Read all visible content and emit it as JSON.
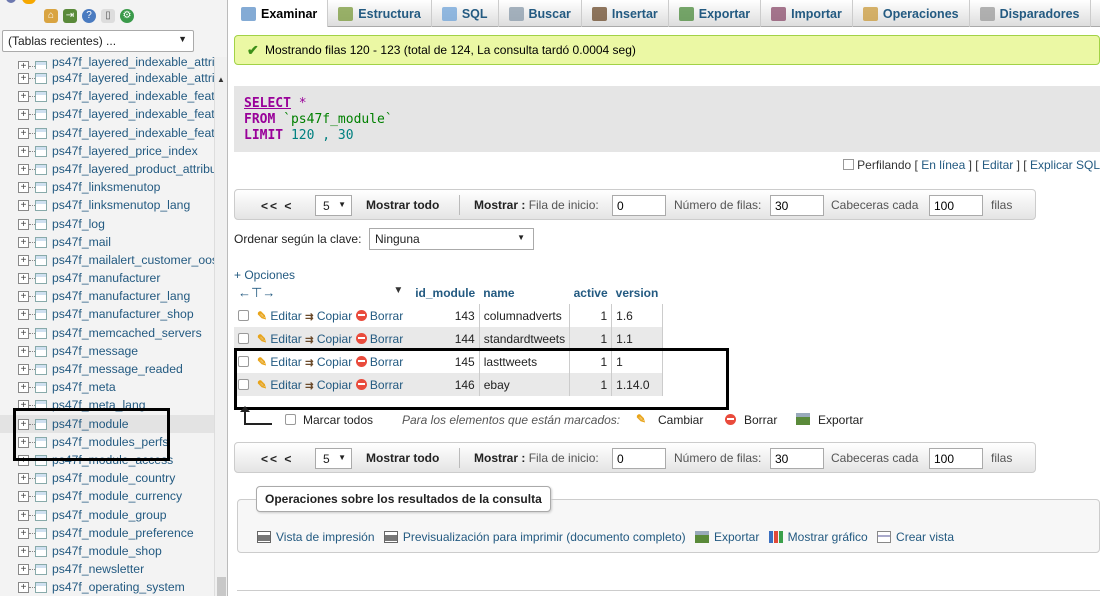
{
  "sidebar": {
    "recent_tables": "(Tablas recientes) ...",
    "tables": [
      "ps47f_layered_indexable_attri",
      "ps47f_layered_indexable_attri",
      "ps47f_layered_indexable_feat",
      "ps47f_layered_indexable_feat",
      "ps47f_layered_indexable_feat",
      "ps47f_layered_price_index",
      "ps47f_layered_product_attribu",
      "ps47f_linksmenutop",
      "ps47f_linksmenutop_lang",
      "ps47f_log",
      "ps47f_mail",
      "ps47f_mailalert_customer_oos",
      "ps47f_manufacturer",
      "ps47f_manufacturer_lang",
      "ps47f_manufacturer_shop",
      "ps47f_memcached_servers",
      "ps47f_message",
      "ps47f_message_readed",
      "ps47f_meta",
      "ps47f_meta_lang",
      "ps47f_module",
      "ps47f_modules_perfs",
      "ps47f_module_access",
      "ps47f_module_country",
      "ps47f_module_currency",
      "ps47f_module_group",
      "ps47f_module_preference",
      "ps47f_module_shop",
      "ps47f_newsletter",
      "ps47f_operating_system"
    ]
  },
  "tabs": [
    {
      "label": "Examinar",
      "icon": "browse-icon",
      "color": "#5b8fc7",
      "active": true
    },
    {
      "label": "Estructura",
      "icon": "structure-icon",
      "color": "#7a9a3a"
    },
    {
      "label": "SQL",
      "icon": "sql-icon",
      "color": "#6fa3d8"
    },
    {
      "label": "Buscar",
      "icon": "search-icon",
      "color": "#8899aa"
    },
    {
      "label": "Insertar",
      "icon": "insert-icon",
      "color": "#6b4a2a"
    },
    {
      "label": "Exportar",
      "icon": "export-icon",
      "color": "#4a8a3a"
    },
    {
      "label": "Importar",
      "icon": "import-icon",
      "color": "#8a4a6a"
    },
    {
      "label": "Operaciones",
      "icon": "wrench-icon",
      "color": "#c99a3a"
    },
    {
      "label": "Disparadores",
      "icon": "triggers-icon",
      "color": "#999999"
    }
  ],
  "success_message": "Mostrando filas 120 - 123 (total de 124, La consulta tardó 0.0004 seg)",
  "sql": {
    "select": "SELECT",
    "star": "*",
    "from": "FROM",
    "table": "`ps47f_module`",
    "limit": "LIMIT",
    "limit_values": "120 , 30"
  },
  "profiling": {
    "label": "Perfilando",
    "inline": "En línea",
    "edit": "Editar",
    "explain": "Explicar SQL"
  },
  "navigation": {
    "arrows": "<< <",
    "rows_select": "5",
    "show_all": "Mostrar todo",
    "show": "Mostrar :",
    "start_row_label": "Fila de inicio:",
    "start_row": "0",
    "num_rows_label": "Número de filas:",
    "num_rows": "30",
    "headers_label": "Cabeceras cada",
    "headers_every": "100",
    "rows_unit": "filas"
  },
  "order": {
    "label": "Ordenar según la clave:",
    "value": "Ninguna"
  },
  "options_link": "+ Opciones",
  "table": {
    "columns": [
      "id_module",
      "name",
      "active",
      "version"
    ],
    "actions": {
      "edit": "Editar",
      "copy": "Copiar",
      "delete": "Borrar"
    },
    "rows": [
      {
        "id_module": "143",
        "name": "columnadverts",
        "active": "1",
        "version": "1.6"
      },
      {
        "id_module": "144",
        "name": "standardtweets",
        "active": "1",
        "version": "1.1"
      },
      {
        "id_module": "145",
        "name": "lasttweets",
        "active": "1",
        "version": "1"
      },
      {
        "id_module": "146",
        "name": "ebay",
        "active": "1",
        "version": "1.14.0"
      }
    ]
  },
  "bulk": {
    "check_all": "Marcar todos",
    "with_selected": "Para los elementos que están marcados:",
    "change": "Cambiar",
    "delete": "Borrar",
    "export": "Exportar"
  },
  "query_ops": {
    "legend": "Operaciones sobre los resultados de la consulta",
    "print_view": "Vista de impresión",
    "print_preview": "Previsualización para imprimir (documento completo)",
    "export": "Exportar",
    "chart": "Mostrar gráfico",
    "create_view": "Crear vista"
  }
}
